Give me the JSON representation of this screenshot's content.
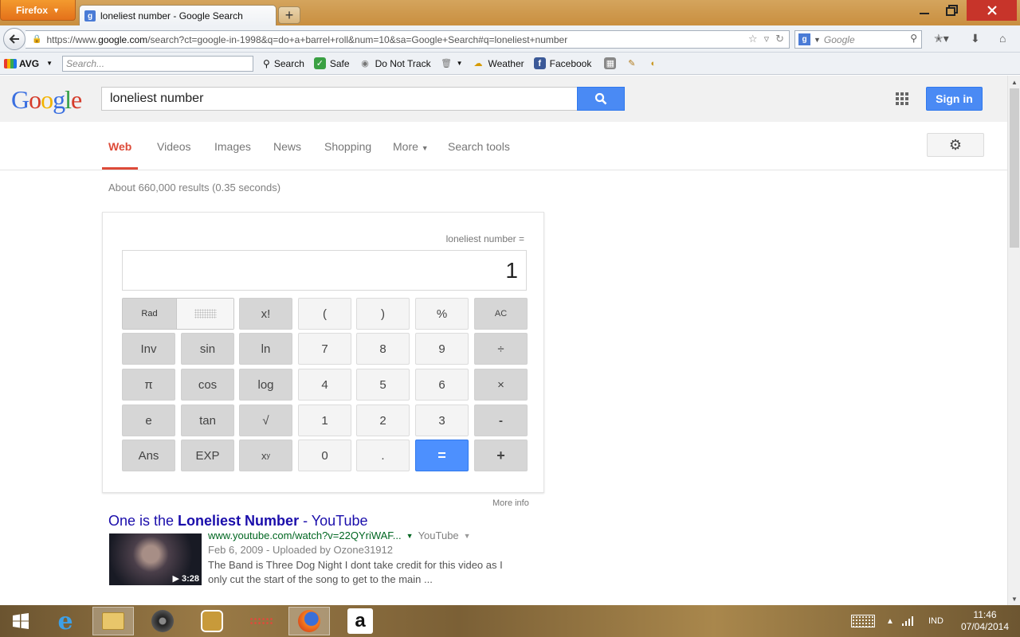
{
  "browser": {
    "menu_label": "Firefox",
    "tab_title": "loneliest number - Google Search",
    "url_prefix": "https://www.",
    "url_domain": "google.com",
    "url_rest": "/search?ct=google-in-1998&q=do+a+barrel+roll&num=10&sa=Google+Search#q=loneliest+number",
    "search_placeholder": "Google"
  },
  "avg_toolbar": {
    "brand": "AVG",
    "search_placeholder": "Search...",
    "search_label": "Search",
    "safe_label": "Safe",
    "dnt_label": "Do Not Track",
    "weather_label": "Weather",
    "facebook_label": "Facebook"
  },
  "google": {
    "logo_letters": [
      "G",
      "o",
      "o",
      "g",
      "l",
      "e"
    ],
    "query": "loneliest number",
    "signin_label": "Sign in",
    "tabs": [
      "Web",
      "Videos",
      "Images",
      "News",
      "Shopping",
      "More",
      "Search tools"
    ],
    "stats": "About 660,000 results (0.35 seconds)"
  },
  "calculator": {
    "expression": "loneliest number =",
    "display": "1",
    "mode_label": "Rad",
    "keys": {
      "fact": "x!",
      "lparen": "(",
      "rparen": ")",
      "pct": "%",
      "ac": "AC",
      "inv": "Inv",
      "sin": "sin",
      "ln": "ln",
      "n7": "7",
      "n8": "8",
      "n9": "9",
      "div": "÷",
      "pi": "π",
      "cos": "cos",
      "log": "log",
      "n4": "4",
      "n5": "5",
      "n6": "6",
      "mul": "×",
      "e": "e",
      "tan": "tan",
      "sqrt": "√",
      "n1": "1",
      "n2": "2",
      "n3": "3",
      "sub": "-",
      "ans": "Ans",
      "exp": "EXP",
      "pow_base": "x",
      "pow_exp": "y",
      "n0": "0",
      "dot": ".",
      "eq": "=",
      "add": "+"
    },
    "more_info": "More info"
  },
  "result": {
    "title_pre": "One is the ",
    "title_bold": "Loneliest Number",
    "title_post": " - YouTube",
    "url": "www.youtube.com/watch?v=22QYriWAF...",
    "source": "YouTube",
    "meta": "Feb 6, 2009 - Uploaded by Ozone31912",
    "snippet": "The Band is Three Dog Night I dont take credit for this video as I only cut the start of the song to get to the main ...",
    "duration": "3:28"
  },
  "taskbar": {
    "lang": "IND",
    "time": "11:46",
    "date": "07/04/2014"
  },
  "colors": {
    "google_blue": "#4a8af4",
    "active_tab_red": "#dd4b39",
    "result_link": "#1a0dab",
    "result_url_green": "#006621",
    "close_red": "#c7342a"
  }
}
